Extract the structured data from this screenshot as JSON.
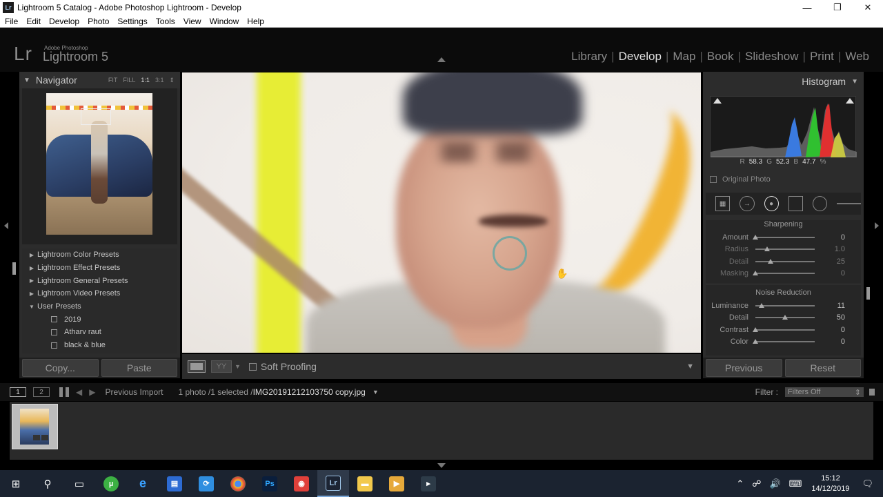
{
  "window": {
    "title": "Lightroom 5 Catalog - Adobe Photoshop Lightroom - Develop",
    "app_icon": "Lr",
    "controls": {
      "minimize": "—",
      "maximize": "❐",
      "close": "✕"
    }
  },
  "menu": [
    "File",
    "Edit",
    "Develop",
    "Photo",
    "Settings",
    "Tools",
    "View",
    "Window",
    "Help"
  ],
  "header": {
    "logo": "Lr",
    "brand_small": "Adobe Photoshop",
    "brand": "Lightroom 5",
    "modules": [
      "Library",
      "Develop",
      "Map",
      "Book",
      "Slideshow",
      "Print",
      "Web"
    ],
    "active_module": "Develop"
  },
  "navigator": {
    "title": "Navigator",
    "zoom_options": [
      "FIT",
      "FILL",
      "1:1",
      "3:1"
    ],
    "selected_zoom": "1:1"
  },
  "presets": [
    {
      "label": "Lightroom Color Presets",
      "expanded": false
    },
    {
      "label": "Lightroom Effect Presets",
      "expanded": false
    },
    {
      "label": "Lightroom General Presets",
      "expanded": false
    },
    {
      "label": "Lightroom Video Presets",
      "expanded": false
    },
    {
      "label": "User Presets",
      "expanded": true
    },
    {
      "label": "2019",
      "child": true
    },
    {
      "label": "Atharv raut",
      "child": true
    },
    {
      "label": "black & blue",
      "child": true
    }
  ],
  "left_buttons": {
    "copy": "Copy...",
    "paste": "Paste"
  },
  "toolbar": {
    "yy": "YY",
    "soft_proofing": "Soft Proofing"
  },
  "histogram": {
    "title": "Histogram",
    "r_label": "R",
    "r_value": "58.3",
    "g_label": "G",
    "g_value": "52.3",
    "b_label": "B",
    "b_value": "47.7",
    "unit": "%",
    "original_photo": "Original Photo"
  },
  "detail": {
    "sharpening_title": "Sharpening",
    "sharpening": [
      {
        "label": "Amount",
        "value": "0",
        "pos": 0.0
      },
      {
        "label": "Radius",
        "value": "1.0",
        "pos": 0.2
      },
      {
        "label": "Detail",
        "value": "25",
        "pos": 0.25
      },
      {
        "label": "Masking",
        "value": "0",
        "pos": 0.0
      }
    ],
    "noise_title": "Noise Reduction",
    "noise": [
      {
        "label": "Luminance",
        "value": "11",
        "pos": 0.11
      },
      {
        "label": "Detail",
        "value": "50",
        "pos": 0.5
      },
      {
        "label": "Contrast",
        "value": "0",
        "pos": 0.0
      },
      {
        "label": "Color",
        "value": "0",
        "pos": 0.0
      }
    ]
  },
  "right_buttons": {
    "previous": "Previous",
    "reset": "Reset"
  },
  "filmstrip_bar": {
    "page1": "1",
    "page2": "2",
    "source": "Previous Import",
    "info": "1 photo /1 selected /",
    "filename": "IMG20191212103750 copy.jpg",
    "filter_label": "Filter :",
    "filter_value": "Filters Off"
  },
  "taskbar": {
    "time": "15:12",
    "date": "14/12/2019"
  },
  "colors": {
    "panel_bg": "#2c2c2c",
    "accent_active": "#e0e0e0",
    "hist_red": "#e03030",
    "hist_green": "#30c030",
    "hist_blue": "#3a7ae0"
  }
}
